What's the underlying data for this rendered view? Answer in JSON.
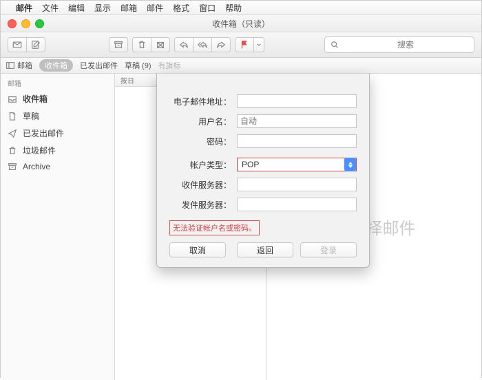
{
  "menubar": {
    "app": "邮件",
    "items": [
      "文件",
      "编辑",
      "显示",
      "邮箱",
      "邮件",
      "格式",
      "窗口",
      "帮助"
    ]
  },
  "window": {
    "title": "收件箱（只读）"
  },
  "search": {
    "placeholder": "搜索"
  },
  "favbar": {
    "mailboxes": "邮箱",
    "inbox": "收件箱",
    "sent": "已发出邮件",
    "drafts": "草稿 (9)",
    "flagged": "有旗标"
  },
  "sidebar": {
    "header": "邮箱",
    "items": [
      {
        "label": "收件箱",
        "icon": "inbox",
        "bold": true
      },
      {
        "label": "草稿",
        "icon": "doc"
      },
      {
        "label": "已发出邮件",
        "icon": "send"
      },
      {
        "label": "垃圾邮件",
        "icon": "trash"
      },
      {
        "label": "Archive",
        "icon": "archive"
      }
    ]
  },
  "list": {
    "sort_header": "按日"
  },
  "preview": {
    "empty": "未选择邮件"
  },
  "sheet": {
    "email_label": "电子邮件地址：",
    "email_value": "",
    "user_label": "用户名：",
    "user_placeholder": "自动",
    "user_value": "",
    "pass_label": "密码：",
    "pass_value": "",
    "type_label": "帐户类型：",
    "type_value": "POP",
    "incoming_label": "收件服务器：",
    "incoming_value": "",
    "outgoing_label": "发件服务器：",
    "outgoing_value": "",
    "error": "无法验证帐户名或密码。",
    "cancel": "取消",
    "back": "返回",
    "signin": "登录"
  }
}
